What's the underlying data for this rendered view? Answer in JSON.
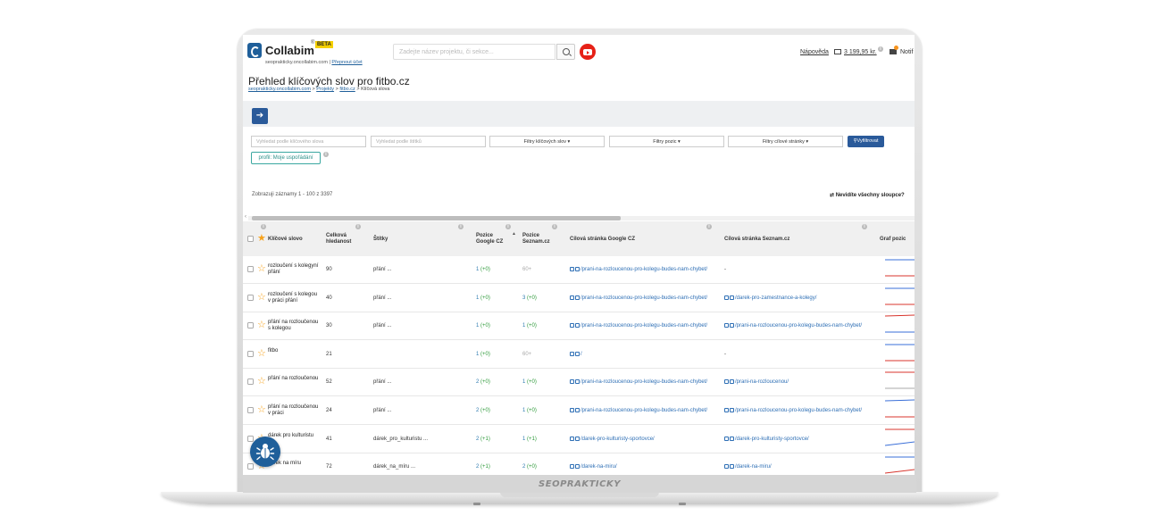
{
  "header": {
    "logo_text": "Collabim",
    "logo_reg": "®",
    "beta": "BETA",
    "domain": "seoprakticky.oncollabim.com",
    "domain_sep": "|",
    "switch_account": "Přepnout účet",
    "search_placeholder": "Zadejte název projektu, či sekce...",
    "help_link": "Nápověda",
    "credit": "3 199,95 kr.",
    "info": "i",
    "notifications": "Notif"
  },
  "page": {
    "title": "Přehled klíčových slov pro fitbo.cz",
    "breadcrumb": [
      {
        "label": "seoprakticky.oncollabim.com"
      },
      {
        "label": "Projekty"
      },
      {
        "label": "fitbo.cz"
      },
      {
        "label": "Klíčová slova"
      }
    ],
    "breadcrumb_sep": ">",
    "arrow": "➔"
  },
  "filters": {
    "keyword_placeholder": "Vyhledat podle klíčového slova",
    "tag_placeholder": "Vyhledat podle štítků",
    "keyword_filters": "Filtry klíčových slov ▾",
    "position_filters": "Filtry pozic ▾",
    "target_filters": "Filtry cílové stránky ▾",
    "submit": "Vyfiltrovat",
    "profile": "profil: Moje uspořádání"
  },
  "records": {
    "text": "Zobrazuji záznamy 1 - 100 z 3397",
    "columns_link": "⇄ Nevidíte všechny sloupce?",
    "scroll_arrow": "‹"
  },
  "table": {
    "headers": {
      "keyword": "Klíčové slovo",
      "search_volume": [
        "Celková",
        "hledanost"
      ],
      "tags": "Štítky",
      "pos_google": [
        "Pozice",
        "Google CZ"
      ],
      "pos_seznam": [
        "Pozice",
        "Seznam.cz"
      ],
      "target_google": "Cílová stránka Google CZ",
      "target_seznam": "Cílová stránka Seznam.cz",
      "graph": "Graf pozic",
      "sort_arrow": "▲"
    },
    "rows": [
      {
        "keyword": [
          "rozloučení s kolegyní",
          "přání"
        ],
        "volume": "90",
        "tags": "přání ...",
        "g_pos": "1",
        "g_delta": "(+0)",
        "s_pos": "60+",
        "s_delta": "",
        "g_url": "/prani-na-rozloucenou-pro-kolegu-budes-nam-chybet/",
        "s_url": "-"
      },
      {
        "keyword": [
          "rozloučení s kolegou",
          "v práci přání"
        ],
        "volume": "40",
        "tags": "přání ...",
        "g_pos": "1",
        "g_delta": "(+0)",
        "s_pos": "3",
        "s_delta": "(+0)",
        "g_url": "/prani-na-rozloucenou-pro-kolegu-budes-nam-chybet/",
        "s_url": "/darek-pro-zamestnance-a-kolegy/"
      },
      {
        "keyword": [
          "přání na rozloučenou",
          "s kolegou"
        ],
        "volume": "30",
        "tags": "přání ...",
        "g_pos": "1",
        "g_delta": "(+0)",
        "s_pos": "1",
        "s_delta": "(+0)",
        "g_url": "/prani-na-rozloucenou-pro-kolegu-budes-nam-chybet/",
        "s_url": "/prani-na-rozloucenou-pro-kolegu-budes-nam-chybet/"
      },
      {
        "keyword": [
          "fitbo",
          ""
        ],
        "volume": "21",
        "tags": "",
        "g_pos": "1",
        "g_delta": "(+0)",
        "s_pos": "60+",
        "s_delta": "",
        "g_url": "/",
        "s_url": "-"
      },
      {
        "keyword": [
          "přání na rozloučenou",
          ""
        ],
        "volume": "52",
        "tags": "přání ...",
        "g_pos": "2",
        "g_delta": "(+0)",
        "s_pos": "1",
        "s_delta": "(+0)",
        "g_url": "/prani-na-rozloucenou-pro-kolegu-budes-nam-chybet/",
        "s_url": "/prani-na-rozloucenou/"
      },
      {
        "keyword": [
          "přání na rozloučenou",
          "v práci"
        ],
        "volume": "24",
        "tags": "přání ...",
        "g_pos": "2",
        "g_delta": "(+0)",
        "s_pos": "1",
        "s_delta": "(+0)",
        "g_url": "/prani-na-rozloucenou-pro-kolegu-budes-nam-chybet/",
        "s_url": "/prani-na-rozloucenou-pro-kolegu-budes-nam-chybet/"
      },
      {
        "keyword": [
          "dárek pro kulturistu",
          ""
        ],
        "volume": "41",
        "tags": "dárek_pro_kulturistu ...",
        "g_pos": "2",
        "g_delta": "(+1)",
        "s_pos": "1",
        "s_delta": "(+1)",
        "g_url": "/darek-pro-kulturisty-sportovce/",
        "s_url": "/darek-pro-kulturisty-sportovce/"
      },
      {
        "keyword": [
          "dárek na míru",
          ""
        ],
        "volume": "72",
        "tags": "dárek_na_míru ...",
        "g_pos": "2",
        "g_delta": "(+1)",
        "s_pos": "2",
        "s_delta": "(+0)",
        "g_url": "/darek-na-miru/",
        "s_url": "/darek-na-miru/"
      }
    ]
  },
  "footer": {
    "brand": "SEOPRAKTICKY"
  },
  "colors": {
    "primary": "#2a5a9a",
    "link": "#2e6fb5",
    "positive": "#2e9a3a",
    "star": "#f7a21b",
    "graph_blue": "#3a6fd8",
    "graph_red": "#d8342c"
  }
}
